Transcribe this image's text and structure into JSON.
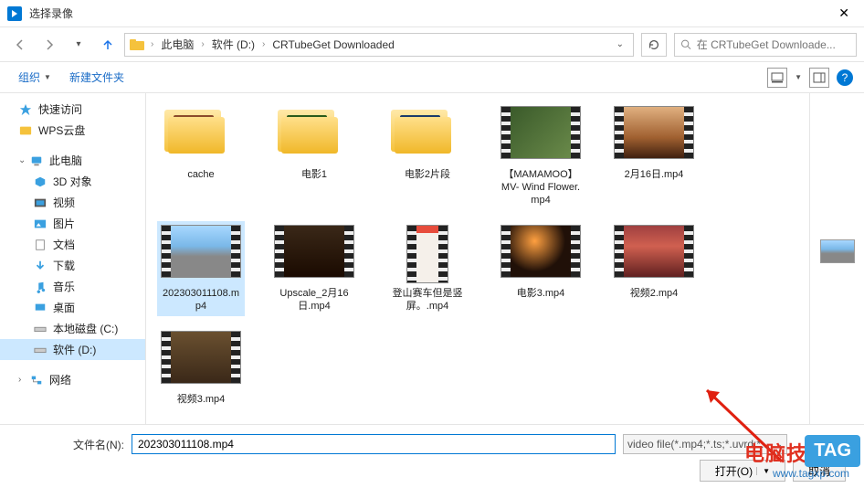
{
  "window": {
    "title": "选择录像"
  },
  "nav": {
    "crumbs": [
      "此电脑",
      "软件 (D:)",
      "CRTubeGet Downloaded"
    ],
    "search_placeholder": "在 CRTubeGet Downloade..."
  },
  "toolbar": {
    "organize": "组织",
    "newfolder": "新建文件夹"
  },
  "sidebar": {
    "quick": "快速访问",
    "wps": "WPS云盘",
    "thispc": "此电脑",
    "obj3d": "3D 对象",
    "videos": "视频",
    "pictures": "图片",
    "docs": "文档",
    "downloads": "下载",
    "music": "音乐",
    "desktop": "桌面",
    "diskc": "本地磁盘 (C:)",
    "diskd": "软件 (D:)",
    "network": "网络"
  },
  "files": {
    "f0": "cache",
    "f1": "电影1",
    "f2": "电影2片段",
    "f3": "【MAMAMOO】MV- Wind Flower.mp4",
    "f4": "2月16日.mp4",
    "f5": "202303011108.mp4",
    "f6": "Upscale_2月16日.mp4",
    "f7": "登山赛车但是竖屏。.mp4",
    "f8": "电影3.mp4",
    "f9": "视频2.mp4",
    "f10": "视频3.mp4"
  },
  "footer": {
    "filename_label": "文件名(N):",
    "filename_value": "202303011108.mp4",
    "filetype": "video file(*.mp4;*.ts;*.uvrd;*...",
    "open": "打开(O)",
    "cancel": "取消"
  },
  "watermark": {
    "red": "电脑技术网",
    "url": "www.tagxp.com",
    "tag": "TAG"
  }
}
